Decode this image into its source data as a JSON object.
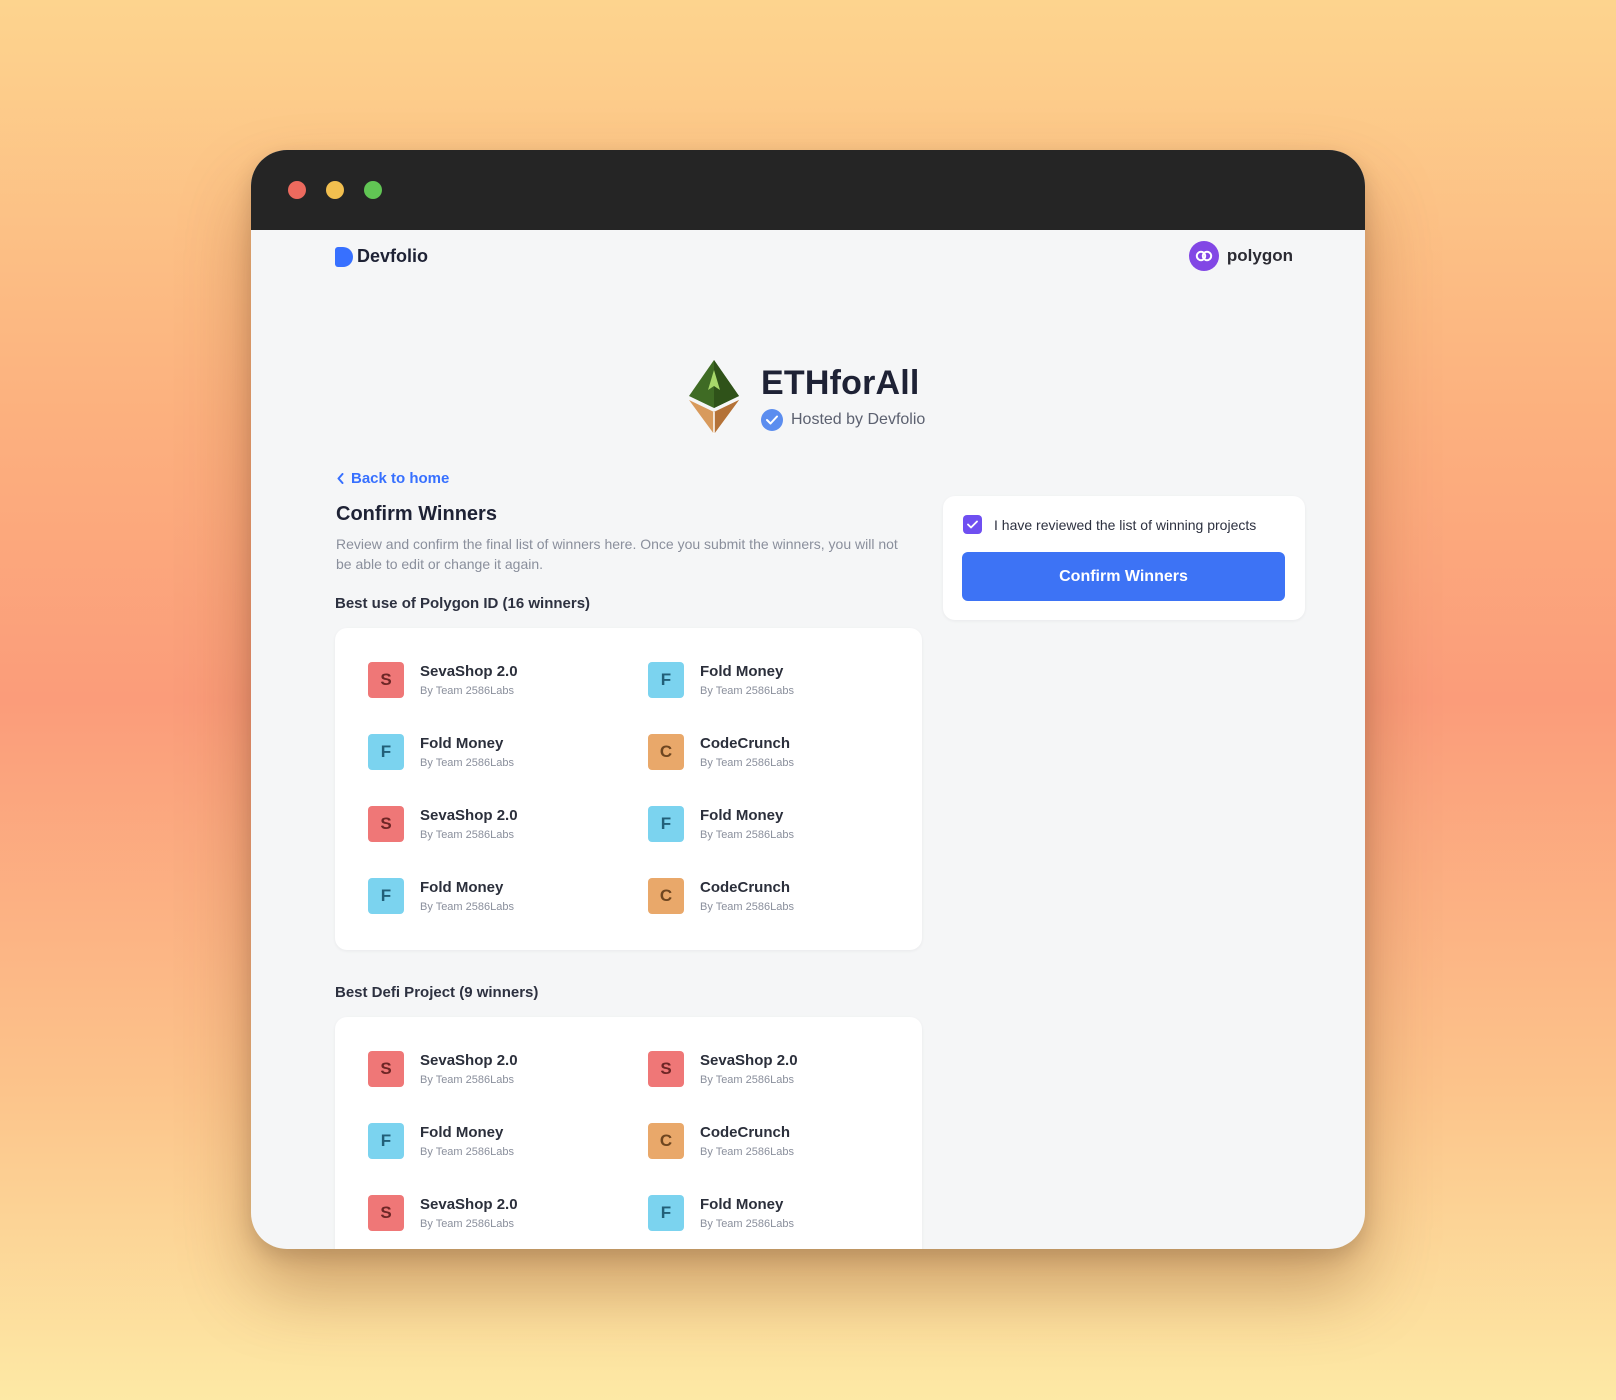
{
  "header": {
    "logo_text": "Devfolio",
    "sponsor_text": "polygon"
  },
  "event": {
    "title": "ETHforAll",
    "host": "Hosted by Devfolio"
  },
  "nav": {
    "back_label": "Back to home"
  },
  "page": {
    "title": "Confirm Winners",
    "description": "Review and confirm the final list of winners here. Once you submit the winners, you will not be able to edit or change it again."
  },
  "review": {
    "checkbox_label": "I have reviewed the list of winning projects",
    "checked": true,
    "button_label": "Confirm Winners"
  },
  "sections": [
    {
      "title": "Best use of Polygon ID (16 winners)",
      "projects": [
        {
          "initial": "S",
          "name": "SevaShop 2.0",
          "team": "By Team 2586Labs"
        },
        {
          "initial": "F",
          "name": "Fold Money",
          "team": "By Team 2586Labs"
        },
        {
          "initial": "F",
          "name": "Fold Money",
          "team": "By Team 2586Labs"
        },
        {
          "initial": "C",
          "name": "CodeCrunch",
          "team": "By Team 2586Labs"
        },
        {
          "initial": "S",
          "name": "SevaShop 2.0",
          "team": "By Team 2586Labs"
        },
        {
          "initial": "F",
          "name": "Fold Money",
          "team": "By Team 2586Labs"
        },
        {
          "initial": "F",
          "name": "Fold Money",
          "team": "By Team 2586Labs"
        },
        {
          "initial": "C",
          "name": "CodeCrunch",
          "team": "By Team 2586Labs"
        }
      ]
    },
    {
      "title": "Best Defi Project (9 winners)",
      "projects": [
        {
          "initial": "S",
          "name": "SevaShop 2.0",
          "team": "By Team 2586Labs"
        },
        {
          "initial": "S",
          "name": "SevaShop 2.0",
          "team": "By Team 2586Labs"
        },
        {
          "initial": "F",
          "name": "Fold Money",
          "team": "By Team 2586Labs"
        },
        {
          "initial": "C",
          "name": "CodeCrunch",
          "team": "By Team 2586Labs"
        },
        {
          "initial": "S",
          "name": "SevaShop 2.0",
          "team": "By Team 2586Labs"
        },
        {
          "initial": "F",
          "name": "Fold Money",
          "team": "By Team 2586Labs"
        }
      ]
    }
  ],
  "colors": {
    "accent": "#3d73f5",
    "checkbox": "#6f4ff1",
    "avatar_s": "#ef7777",
    "avatar_f": "#7bd3ef",
    "avatar_c": "#e9a86a"
  },
  "icons": [
    "devfolio-logo-icon",
    "polygon-logo-icon",
    "ethforall-logo-icon",
    "verified-check-icon",
    "chevron-left-icon",
    "checkmark-icon"
  ]
}
